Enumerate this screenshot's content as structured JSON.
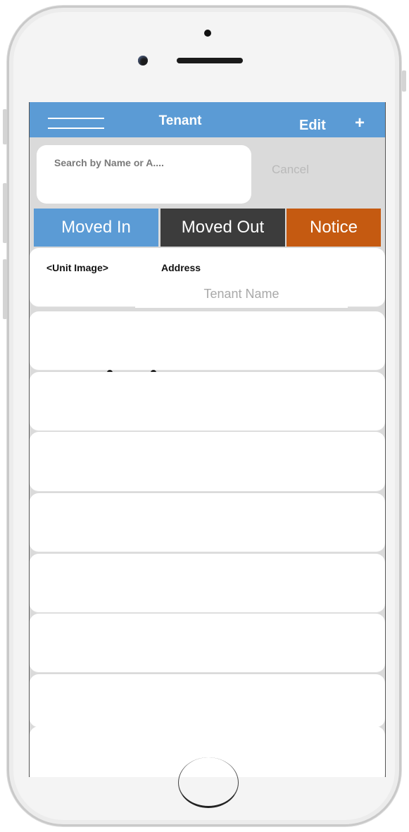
{
  "nav": {
    "title": "Tenant",
    "edit_label": "Edit",
    "add_label": "+"
  },
  "search": {
    "placeholder": "Search by Name or A....",
    "cancel_label": "Cancel"
  },
  "segments": [
    {
      "label": "Moved In",
      "color": "#5b9bd5"
    },
    {
      "label": "Moved Out",
      "color": "#3c3c3c"
    },
    {
      "label": "Notice",
      "color": "#c55a11"
    }
  ],
  "first_row": {
    "image_label": "<Unit  Image>",
    "address_label": "Address",
    "tenant_name": "Tenant Name"
  },
  "colors": {
    "nav_bg": "#5b9bd5",
    "screen_bg": "#dadada",
    "row_bg": "#ffffff"
  }
}
